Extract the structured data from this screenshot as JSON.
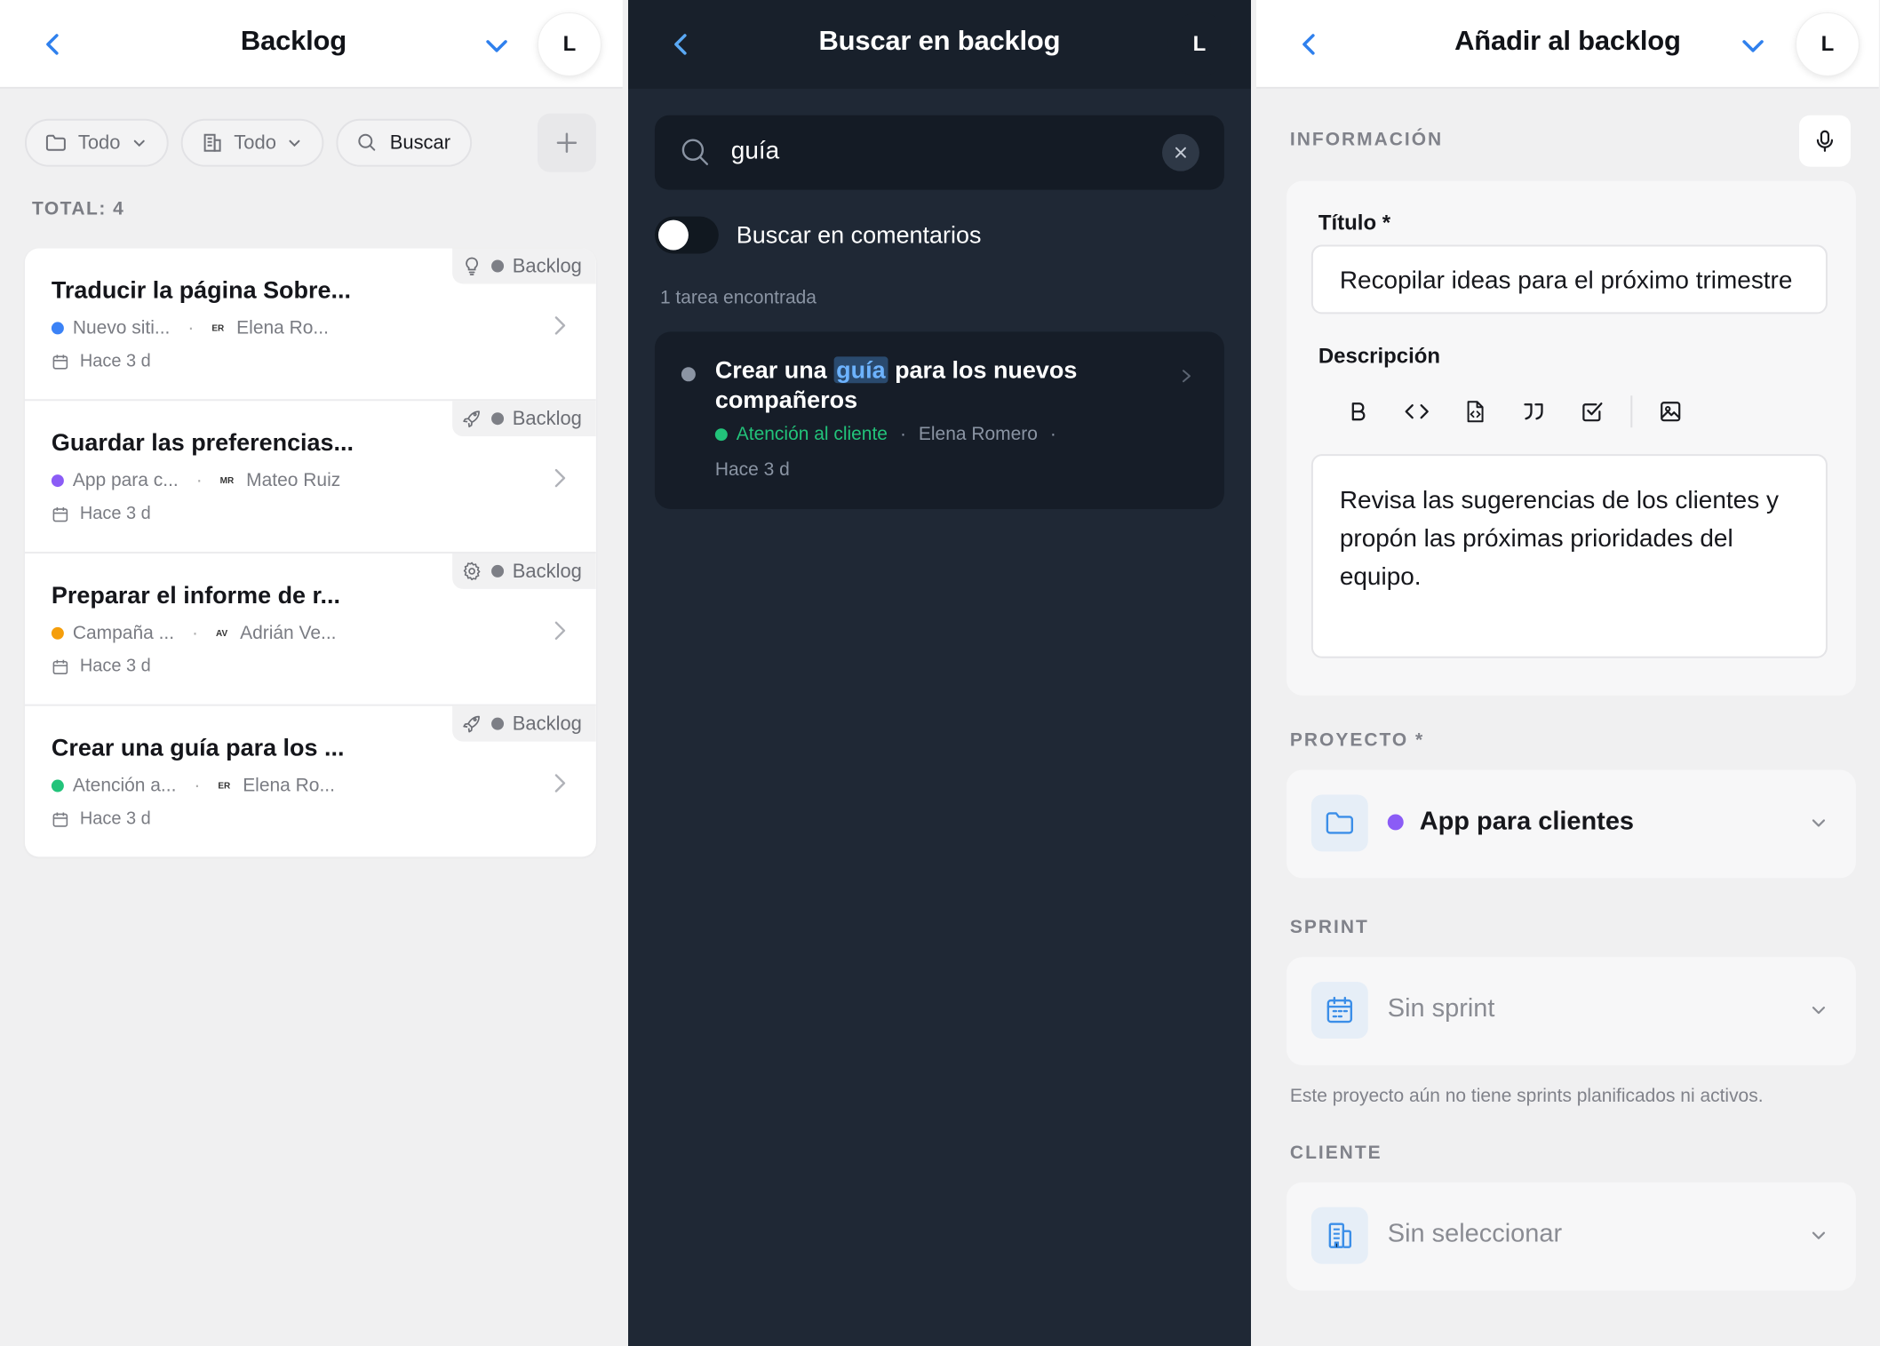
{
  "backlog": {
    "title": "Backlog",
    "avatar": "L",
    "filters": [
      {
        "label": "Todo",
        "icon": "folder-icon"
      },
      {
        "label": "Todo",
        "icon": "building-icon"
      }
    ],
    "search_label": "Buscar",
    "total": "TOTAL: 4",
    "tasks": [
      {
        "title": "Traducir la página Sobre...",
        "status": "Backlog",
        "type_icon": "lightbulb-icon",
        "project": "Nuevo siti...",
        "project_color": "#3b82f6",
        "initials": "ER",
        "assignee": "Elena Ro...",
        "date": "Hace 3 d"
      },
      {
        "title": "Guardar las preferencias...",
        "status": "Backlog",
        "type_icon": "rocket-icon",
        "project": "App para c...",
        "project_color": "#8b5cf6",
        "initials": "MR",
        "assignee": "Mateo Ruiz",
        "date": "Hace 3 d"
      },
      {
        "title": "Preparar el informe de r...",
        "status": "Backlog",
        "type_icon": "gear-icon",
        "project": "Campaña ...",
        "project_color": "#f59e0b",
        "initials": "AV",
        "assignee": "Adrián Ve...",
        "date": "Hace 3 d"
      },
      {
        "title": "Crear una guía para los ...",
        "status": "Backlog",
        "type_icon": "rocket-icon",
        "project": "Atención a...",
        "project_color": "#22c37a",
        "initials": "ER",
        "assignee": "Elena Ro...",
        "date": "Hace 3 d"
      }
    ]
  },
  "search": {
    "title": "Buscar en backlog",
    "avatar": "L",
    "query": "guía",
    "toggle_label": "Buscar en comentarios",
    "toggle_on": false,
    "found": "1 tarea encontrada",
    "result": {
      "title_before": "Crear una ",
      "title_match": "guía",
      "title_after": " para los nuevos compañeros",
      "project": "Atención al cliente",
      "assignee": "Elena Romero",
      "date": "Hace 3 d"
    }
  },
  "add": {
    "title": "Añadir al backlog",
    "avatar": "L",
    "info_section": "INFORMACIÓN",
    "title_label": "Título *",
    "title_value": "Recopilar ideas para el próximo trimestre",
    "desc_label": "Descripción",
    "toolbar_icons": [
      "bold-icon",
      "code-icon",
      "code-file-icon",
      "quote-icon",
      "checkbox-icon",
      "image-icon"
    ],
    "description": "Revisa las sugerencias de los clientes y propón las próximas prioridades del equipo.",
    "project_section": "PROYECTO *",
    "project_value": "App para clientes",
    "project_color": "#8b5cf6",
    "sprint_section": "SPRINT",
    "sprint_value": "Sin sprint",
    "sprint_note": "Este proyecto aún no tiene sprints planificados ni activos.",
    "client_section": "CLIENTE",
    "client_value": "Sin seleccionar"
  },
  "colors": {
    "accent": "#2f80ed",
    "dark_bg": "#1f2835",
    "success": "#22c37a"
  }
}
